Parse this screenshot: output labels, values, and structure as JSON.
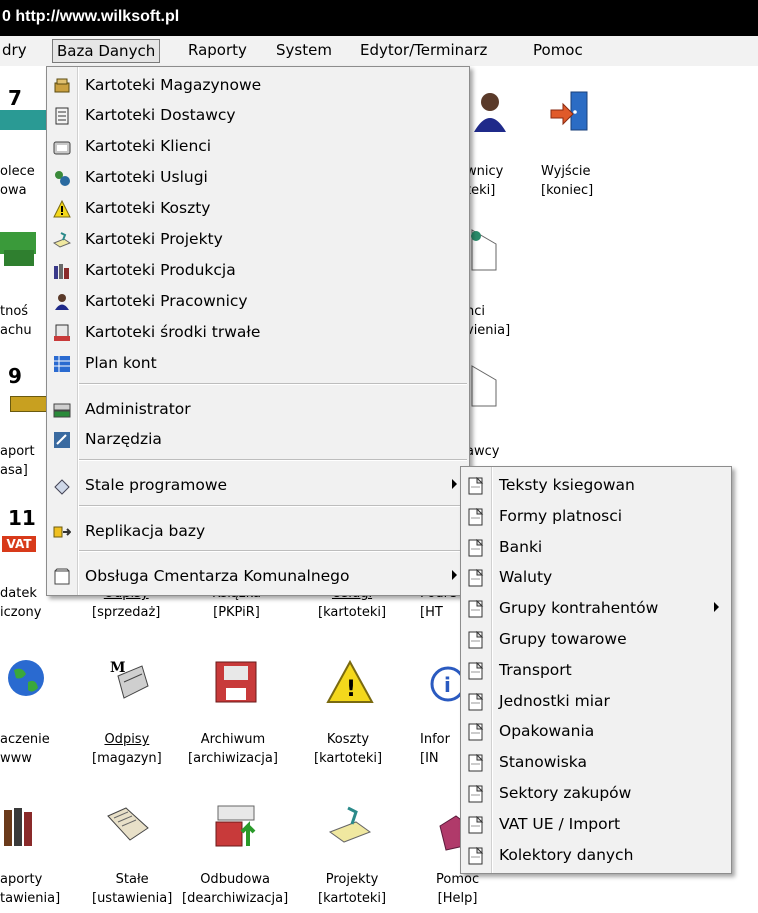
{
  "window": {
    "title": "0  http://www.wilksoft.pl"
  },
  "menubar": {
    "items": [
      "dry",
      "Baza Danych",
      "Raporty",
      "System",
      "Edytor/Terminarz",
      "Pomoc"
    ]
  },
  "dropdown": {
    "items": [
      {
        "label": "Kartoteki Magazynowe",
        "icon": "warehouse-icon"
      },
      {
        "label": "Kartoteki Dostawcy",
        "icon": "supplier-icon"
      },
      {
        "label": "Kartoteki Klienci",
        "icon": "clients-icon"
      },
      {
        "label": "Kartoteki Uslugi",
        "icon": "services-icon"
      },
      {
        "label": "Kartoteki Koszty",
        "icon": "warning-icon"
      },
      {
        "label": "Kartoteki Projekty",
        "icon": "projects-icon"
      },
      {
        "label": "Kartoteki Produkcja",
        "icon": "production-icon"
      },
      {
        "label": "Kartoteki Pracownicy",
        "icon": "employee-icon"
      },
      {
        "label": "Kartoteki środki trwałe",
        "icon": "assets-icon"
      },
      {
        "label": "Plan kont",
        "icon": "accounts-icon"
      },
      {
        "label": "Administrator",
        "icon": "admin-icon"
      },
      {
        "label": "Narzędzia",
        "icon": "tools-icon"
      },
      {
        "label": "Stale programowe",
        "icon": "constants-icon"
      },
      {
        "label": "Replikacja bazy",
        "icon": "replication-icon"
      },
      {
        "label": "Obsługa Cmentarza Komunalnego",
        "icon": "cemetery-icon"
      }
    ]
  },
  "submenu": {
    "items": [
      "Teksty ksiegowan",
      "Formy platnosci",
      "Banki",
      "Waluty",
      "Grupy kontrahentów",
      "Grupy towarowe",
      "Transport",
      "Jednostki miar",
      "Opakowania",
      "Stanowiska",
      "Sektory zakupów",
      "VAT UE / Import",
      "Kolektory danych"
    ]
  },
  "desktop": {
    "number_labels": [
      "7",
      "9",
      "11"
    ],
    "labels": [
      {
        "l1": "olece",
        "l2": "owa"
      },
      {
        "l1": "wnicy",
        "l2": "teki]"
      },
      {
        "l1": "Wyjście",
        "l2": "[koniec]"
      },
      {
        "l1": "tnoś",
        "l2": "achu"
      },
      {
        "l1": "nci",
        "l2": "vienia]"
      },
      {
        "l1": "aport",
        "l2": "asa]"
      },
      {
        "l1": "awcy",
        "l2": ""
      },
      {
        "l1": "datek",
        "l2": "iczony"
      },
      {
        "l1": "Odpisy",
        "l2": "[sprzedaż]"
      },
      {
        "l1": "Ksiązka",
        "l2": "[PKPiR]"
      },
      {
        "l1": "Usługi",
        "l2": "[kartoteki]"
      },
      {
        "l1": "Podre",
        "l2": "[HT"
      },
      {
        "l1": "aczenie",
        "l2": "www"
      },
      {
        "l1": "Odpisy",
        "l2": "[magazyn]"
      },
      {
        "l1": "Archiwum",
        "l2": "[archiwizacja]"
      },
      {
        "l1": "Koszty",
        "l2": "[kartoteki]"
      },
      {
        "l1": "Infor",
        "l2": "[IN"
      },
      {
        "l1": "aporty",
        "l2": "tawienia]"
      },
      {
        "l1": "Stałe",
        "l2": "[ustawienia]"
      },
      {
        "l1": "Odbudowa",
        "l2": "[dearchiwizacja]"
      },
      {
        "l1": "Projekty",
        "l2": "[kartoteki]"
      },
      {
        "l1": "Pomoc",
        "l2": "[Help]"
      }
    ],
    "vat_badge": "VAT"
  }
}
